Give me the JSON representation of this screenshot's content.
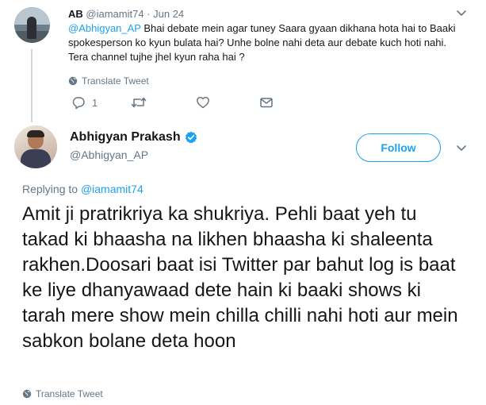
{
  "reply": {
    "name": "AB",
    "meta": "@iamamit74 · Jun 24",
    "mention": "@Abhigyan_AP",
    "text": " Bhai debate mein agar tuney Saara gyaan dikhana hota hai to Baaki spokesperson ko kyun bulata hai? Unhe bolne nahi deta aur debate kuch hoti nahi. Tera channel tujhe jhel kyun raha hai ?",
    "translate": "Translate Tweet",
    "reply_count": "1"
  },
  "main_tweet": {
    "name": "Abhigyan Prakash",
    "handle": "@Abhigyan_AP",
    "follow_label": "Follow",
    "replying_label": "Replying to ",
    "replying_handle": "@iamamit74",
    "text": "Amit ji pratrikriya ka shukriya. Pehli baat yeh tu takad ki bhaasha na likhen bhaasha ki shaleenta rakhen.Doosari baat isi Twitter par bahut log is baat ke liye dhanyawaad dete hain ki baaki shows ki tarah mere show mein chilla chilli nahi hoti aur mein sabkon bolane deta hoon",
    "translate": "Translate Tweet"
  },
  "colors": {
    "accent": "#1da1f2",
    "muted": "#657786",
    "text": "#14171a",
    "thread_line": "#ccd6dd"
  },
  "icons": [
    "globe-icon",
    "reply-icon",
    "retweet-icon",
    "like-icon",
    "dm-icon",
    "chevron-down-icon",
    "verified-badge-icon"
  ]
}
